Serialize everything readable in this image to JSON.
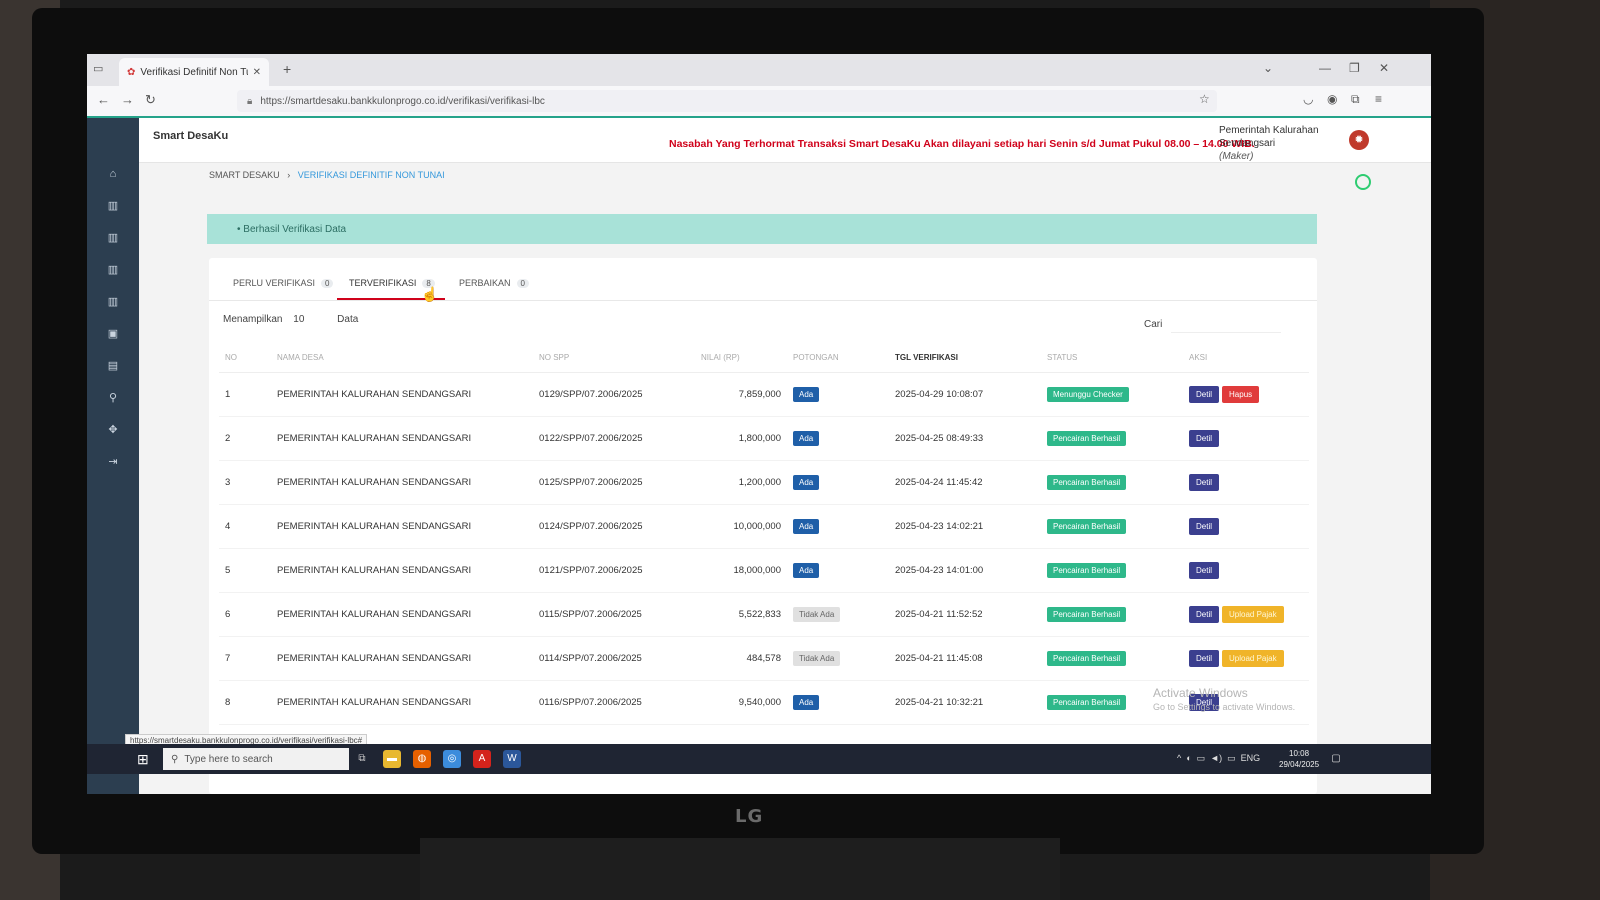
{
  "browser": {
    "tab_title": "Verifikasi Definitif Non Tunai - S",
    "url": "https://smartdesaku.bankkulonprogo.co.id/verifikasi/verifikasi-lbc",
    "status_url": "https://smartdesaku.bankkulonprogo.co.id/verifikasi/verifikasi-lbc#"
  },
  "app": {
    "name": "Smart DesaKu",
    "notice": "Nasabah Yang Terhormat Transaksi Smart DesaKu Akan dilayani setiap hari Senin s/d Jumat Pukul 08.00 – 14.00 WIB.",
    "user_line1": "Pemerintah Kalurahan",
    "user_line2": "Sendangsari",
    "user_role": "(Maker)"
  },
  "breadcrumb": {
    "root": "SMART DESAKU",
    "current": "VERIFIKASI DEFINITIF NON TUNAI"
  },
  "alert": "Berhasil Verifikasi Data",
  "tabs": [
    {
      "label": "PERLU VERIFIKASI",
      "count": "0"
    },
    {
      "label": "TERVERIFIKASI",
      "count": "8"
    },
    {
      "label": "PERBAIKAN",
      "count": "0"
    }
  ],
  "controls": {
    "show_label": "Menampilkan",
    "show_value": "10",
    "show_suffix": "Data",
    "search_label": "Cari"
  },
  "table": {
    "headers": [
      "NO",
      "NAMA DESA",
      "NO SPP",
      "NILAI (RP)",
      "POTONGAN",
      "TGL VERIFIKASI",
      "STATUS",
      "AKSI"
    ],
    "rows": [
      {
        "no": "1",
        "desa": "PEMERINTAH KALURAHAN SENDANGSARI",
        "spp": "0129/SPP/07.2006/2025",
        "nilai": "7,859,000",
        "potongan": "Ada",
        "tgl": "2025-04-29 10:08:07",
        "status": "Menunggu Checker",
        "detil": "Detil",
        "hapus": "Hapus",
        "pajak": ""
      },
      {
        "no": "2",
        "desa": "PEMERINTAH KALURAHAN SENDANGSARI",
        "spp": "0122/SPP/07.2006/2025",
        "nilai": "1,800,000",
        "potongan": "Ada",
        "tgl": "2025-04-25 08:49:33",
        "status": "Pencairan Berhasil",
        "detil": "Detil",
        "hapus": "",
        "pajak": ""
      },
      {
        "no": "3",
        "desa": "PEMERINTAH KALURAHAN SENDANGSARI",
        "spp": "0125/SPP/07.2006/2025",
        "nilai": "1,200,000",
        "potongan": "Ada",
        "tgl": "2025-04-24 11:45:42",
        "status": "Pencairan Berhasil",
        "detil": "Detil",
        "hapus": "",
        "pajak": ""
      },
      {
        "no": "4",
        "desa": "PEMERINTAH KALURAHAN SENDANGSARI",
        "spp": "0124/SPP/07.2006/2025",
        "nilai": "10,000,000",
        "potongan": "Ada",
        "tgl": "2025-04-23 14:02:21",
        "status": "Pencairan Berhasil",
        "detil": "Detil",
        "hapus": "",
        "pajak": ""
      },
      {
        "no": "5",
        "desa": "PEMERINTAH KALURAHAN SENDANGSARI",
        "spp": "0121/SPP/07.2006/2025",
        "nilai": "18,000,000",
        "potongan": "Ada",
        "tgl": "2025-04-23 14:01:00",
        "status": "Pencairan Berhasil",
        "detil": "Detil",
        "hapus": "",
        "pajak": ""
      },
      {
        "no": "6",
        "desa": "PEMERINTAH KALURAHAN SENDANGSARI",
        "spp": "0115/SPP/07.2006/2025",
        "nilai": "5,522,833",
        "potongan": "Tidak Ada",
        "tgl": "2025-04-21 11:52:52",
        "status": "Pencairan Berhasil",
        "detil": "Detil",
        "hapus": "",
        "pajak": "Upload Pajak"
      },
      {
        "no": "7",
        "desa": "PEMERINTAH KALURAHAN SENDANGSARI",
        "spp": "0114/SPP/07.2006/2025",
        "nilai": "484,578",
        "potongan": "Tidak Ada",
        "tgl": "2025-04-21 11:45:08",
        "status": "Pencairan Berhasil",
        "detil": "Detil",
        "hapus": "",
        "pajak": "Upload Pajak"
      },
      {
        "no": "8",
        "desa": "PEMERINTAH KALURAHAN SENDANGSARI",
        "spp": "0116/SPP/07.2006/2025",
        "nilai": "9,540,000",
        "potongan": "Ada",
        "tgl": "2025-04-21 10:32:21",
        "status": "Pencairan Berhasil",
        "detil": "Detil",
        "hapus": "",
        "pajak": ""
      }
    ]
  },
  "watermark": {
    "line1": "Activate Windows",
    "line2": "Go to Settings to activate Windows."
  },
  "taskbar": {
    "search_placeholder": "Type here to search",
    "lang": "ENG",
    "time": "10:08",
    "date": "29/04/2025"
  },
  "monitor_brand": "LG"
}
